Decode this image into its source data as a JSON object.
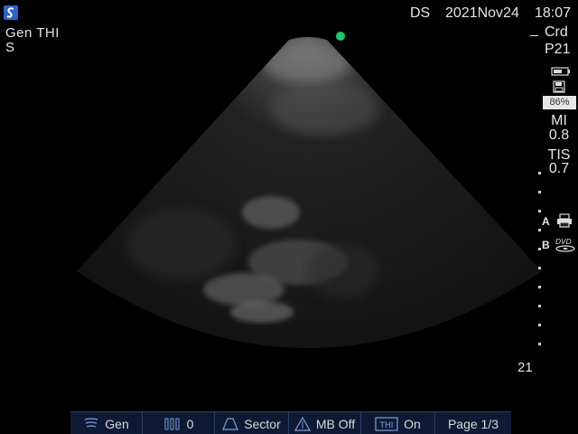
{
  "status": {
    "mode_line": "Gen  THI",
    "mode_sub": "S"
  },
  "header": {
    "ds": "DS",
    "date": "2021Nov24",
    "time": "18:07"
  },
  "right_panel": {
    "depth_dash": "_",
    "preset": "Crd",
    "probe": "P21",
    "storage_percent": "86%",
    "mi_label": "MI",
    "mi_value": "0.8",
    "tis_label": "TIS",
    "tis_value": "0.7",
    "printer_label": "A",
    "dvd_label": "B",
    "depth_value": "21"
  },
  "toolbar": {
    "items": [
      {
        "icon": "probe-freq-icon",
        "label": "Gen"
      },
      {
        "icon": "gain-bars-icon",
        "label": "0"
      },
      {
        "icon": "sector-icon",
        "label": "Sector"
      },
      {
        "icon": "mb-icon",
        "label": "MB Off"
      },
      {
        "icon": "thi-icon",
        "label": "On"
      },
      {
        "icon": "",
        "label": "Page 1/3"
      }
    ]
  },
  "colors": {
    "accent_green": "#1fc46b",
    "toolbar_bg": "#0e1a33",
    "logo_blue": "#2f62c8"
  }
}
